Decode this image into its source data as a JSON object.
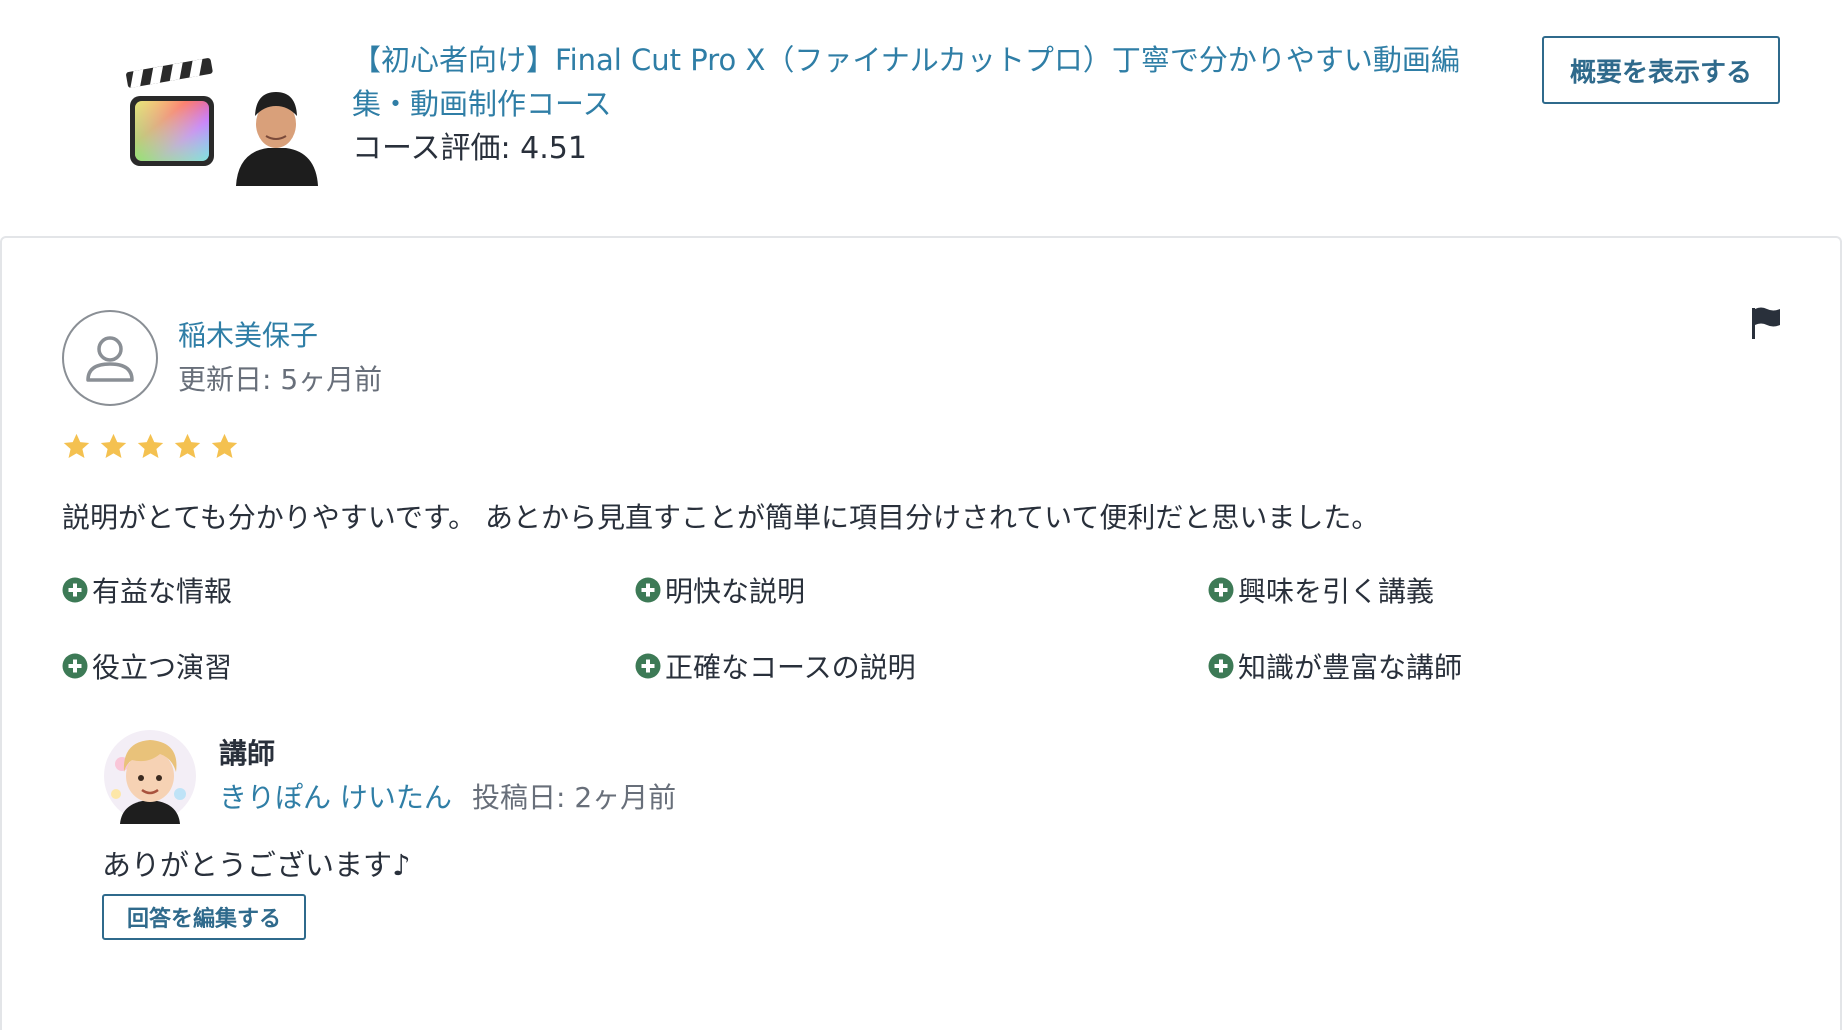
{
  "course": {
    "title": "【初心者向け】Final Cut Pro X（ファイナルカットプロ）丁寧で分かりやすい動画編集・動画制作コース",
    "rating": "コース評価: 4.51",
    "overview_button": "概要を表示する"
  },
  "review": {
    "reviewer_name": "稲木美保子",
    "updated": "更新日: 5ヶ月前",
    "stars": 5,
    "text": "説明がとても分かりやすいです。 あとから見直すことが簡単に項目分けされていて便利だと思いました。",
    "tags": [
      "有益な情報",
      "明快な説明",
      "興味を引く講義",
      "役立つ演習",
      "正確なコースの説明",
      "知識が豊富な講師"
    ]
  },
  "reply": {
    "role": "講師",
    "instructor_name": "きりぽん けいたん",
    "posted": "投稿日: 2ヶ月前",
    "text": "ありがとうございます♪",
    "edit_button": "回答を編集する"
  },
  "colors": {
    "link": "#2f7ea6",
    "button_border": "#2f6a8c",
    "star": "#f4c150",
    "tag_icon": "#3d7a56"
  },
  "icons": [
    "course-thumbnail",
    "user-avatar-icon",
    "flag-icon",
    "star-icon",
    "plus-circle-icon",
    "instructor-avatar"
  ]
}
